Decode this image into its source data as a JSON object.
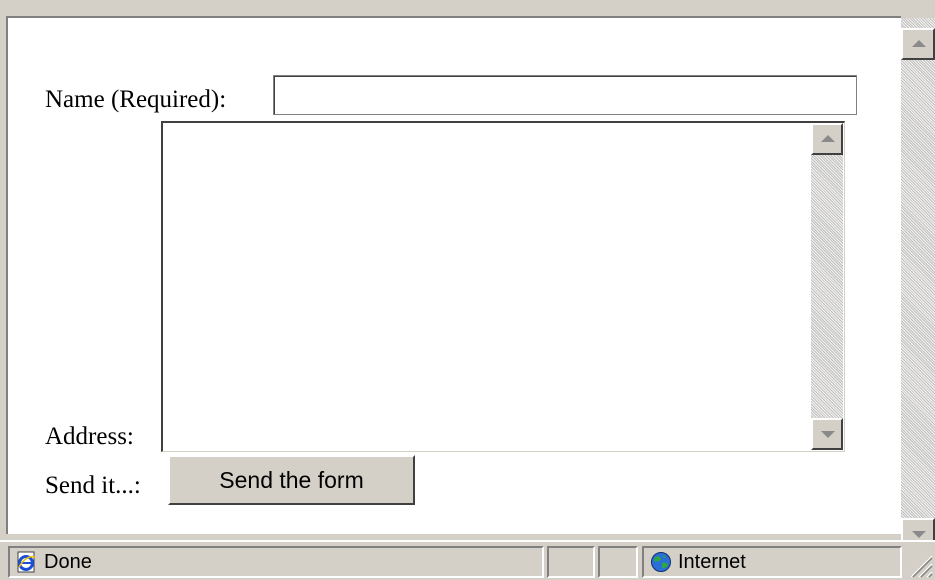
{
  "form": {
    "name_label": "Name (Required):",
    "name_value": "",
    "address_label": "Address:",
    "address_value": "",
    "send_label": "Send it...:",
    "send_button": "Send the form"
  },
  "statusbar": {
    "status_text": "Done",
    "status_icon": "ie-page-icon",
    "zone_text": "Internet",
    "zone_icon": "globe-icon"
  }
}
